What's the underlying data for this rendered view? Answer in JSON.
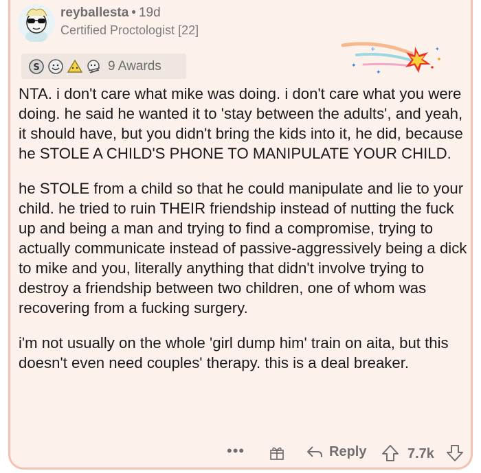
{
  "comment": {
    "username": "reyballesta",
    "separator": "•",
    "age": "19d",
    "flair": "Certified Proctologist [22]",
    "awards_label": "9 Awards",
    "award_icons": [
      "silver-award-icon",
      "wholesome-award-icon",
      "helpful-award-icon",
      "hugz-award-icon"
    ],
    "paragraphs": [
      "NTA. i don't care what mike was doing. i don't care what you were doing. he said he wanted it to 'stay between the adults', and yeah, it should have, but you didn't bring the kids into it, he did, because he STOLE A CHILD'S PHONE TO MANIPULATE YOUR CHILD.",
      "he STOLE from a child so that he could manipulate and lie to your child. he tried to ruin THEIR friendship instead of nutting the fuck up and being a man and trying to find a compromise, trying to actually communicate instead of passive-aggressively being a dick to mike and you, literally anything that didn't involve trying to destroy a friendship between two children, one of whom was recovering from a fucking surgery.",
      "i'm not usually on the whole 'girl dump him' train on aita, but this doesn't even need couples' therapy. this is a deal breaker."
    ],
    "actions": {
      "more": "•••",
      "reply": "Reply",
      "score": "7.7k"
    }
  },
  "colors": {
    "card_background": "#fdf1ec",
    "card_border": "#f3c2b2",
    "muted_text": "#6e6e6e",
    "body_text": "#1a1a1b"
  }
}
